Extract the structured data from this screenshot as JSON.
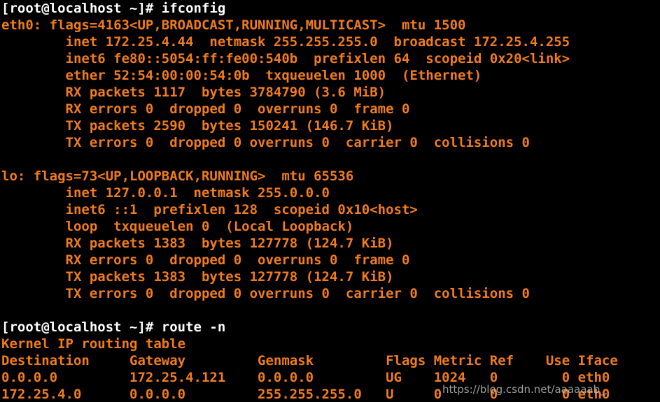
{
  "terminal": {
    "colors": {
      "background": "#000000",
      "prompt": "#ffffff",
      "output": "#f07c1e"
    },
    "lines": [
      "[root@localhost ~]# ifconfig",
      "eth0: flags=4163<UP,BROADCAST,RUNNING,MULTICAST>  mtu 1500",
      "        inet 172.25.4.44  netmask 255.255.255.0  broadcast 172.25.4.255",
      "        inet6 fe80::5054:ff:fe00:540b  prefixlen 64  scopeid 0x20<link>",
      "        ether 52:54:00:00:54:0b  txqueuelen 1000  (Ethernet)",
      "        RX packets 1117  bytes 3784790 (3.6 MiB)",
      "        RX errors 0  dropped 0  overruns 0  frame 0",
      "        TX packets 2590  bytes 150241 (146.7 KiB)",
      "        TX errors 0  dropped 0 overruns 0  carrier 0  collisions 0",
      "",
      "lo: flags=73<UP,LOOPBACK,RUNNING>  mtu 65536",
      "        inet 127.0.0.1  netmask 255.0.0.0",
      "        inet6 ::1  prefixlen 128  scopeid 0x10<host>",
      "        loop  txqueuelen 0  (Local Loopback)",
      "        RX packets 1383  bytes 127778 (124.7 KiB)",
      "        RX errors 0  dropped 0  overruns 0  frame 0",
      "        TX packets 1383  bytes 127778 (124.7 KiB)",
      "        TX errors 0  dropped 0 overruns 0  carrier 0  collisions 0",
      "",
      "[root@localhost ~]# route -n",
      "Kernel IP routing table",
      "Destination     Gateway         Genmask         Flags Metric Ref    Use Iface",
      "0.0.0.0         172.25.4.121    0.0.0.0         UG    1024   0        0 eth0",
      "172.25.4.0      0.0.0.0         255.255.255.0   U     0      0        0 eth0"
    ],
    "watermark": "https://blog.csdn.net/aaaaaab_"
  }
}
